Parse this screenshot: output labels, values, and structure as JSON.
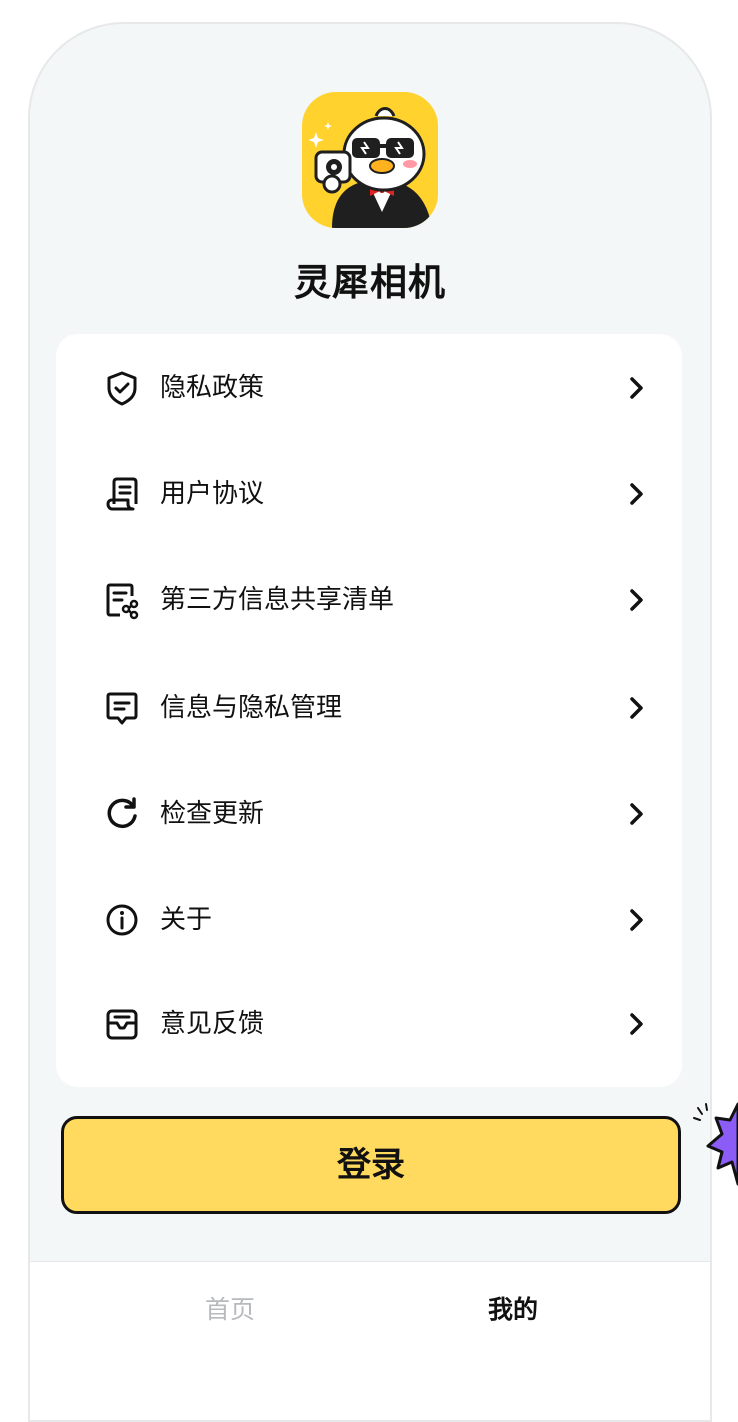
{
  "app": {
    "name": "灵犀相机",
    "icon_name": "duck-mascot-camera-logo",
    "brand_color": "#ffd22e"
  },
  "menu": {
    "items": [
      {
        "label": "隐私政策",
        "icon": "shield-check-icon"
      },
      {
        "label": "用户协议",
        "icon": "document-scroll-icon"
      },
      {
        "label": "第三方信息共享清单",
        "icon": "share-list-icon"
      },
      {
        "label": "信息与隐私管理",
        "icon": "message-box-icon"
      },
      {
        "label": "检查更新",
        "icon": "refresh-icon"
      },
      {
        "label": "关于",
        "icon": "info-icon"
      },
      {
        "label": "意见反馈",
        "icon": "feedback-inbox-icon"
      }
    ]
  },
  "login": {
    "label": "登录",
    "color": "#ffda5e"
  },
  "tabbar": {
    "home_label": "首页",
    "mine_label": "我的",
    "active": "mine"
  }
}
